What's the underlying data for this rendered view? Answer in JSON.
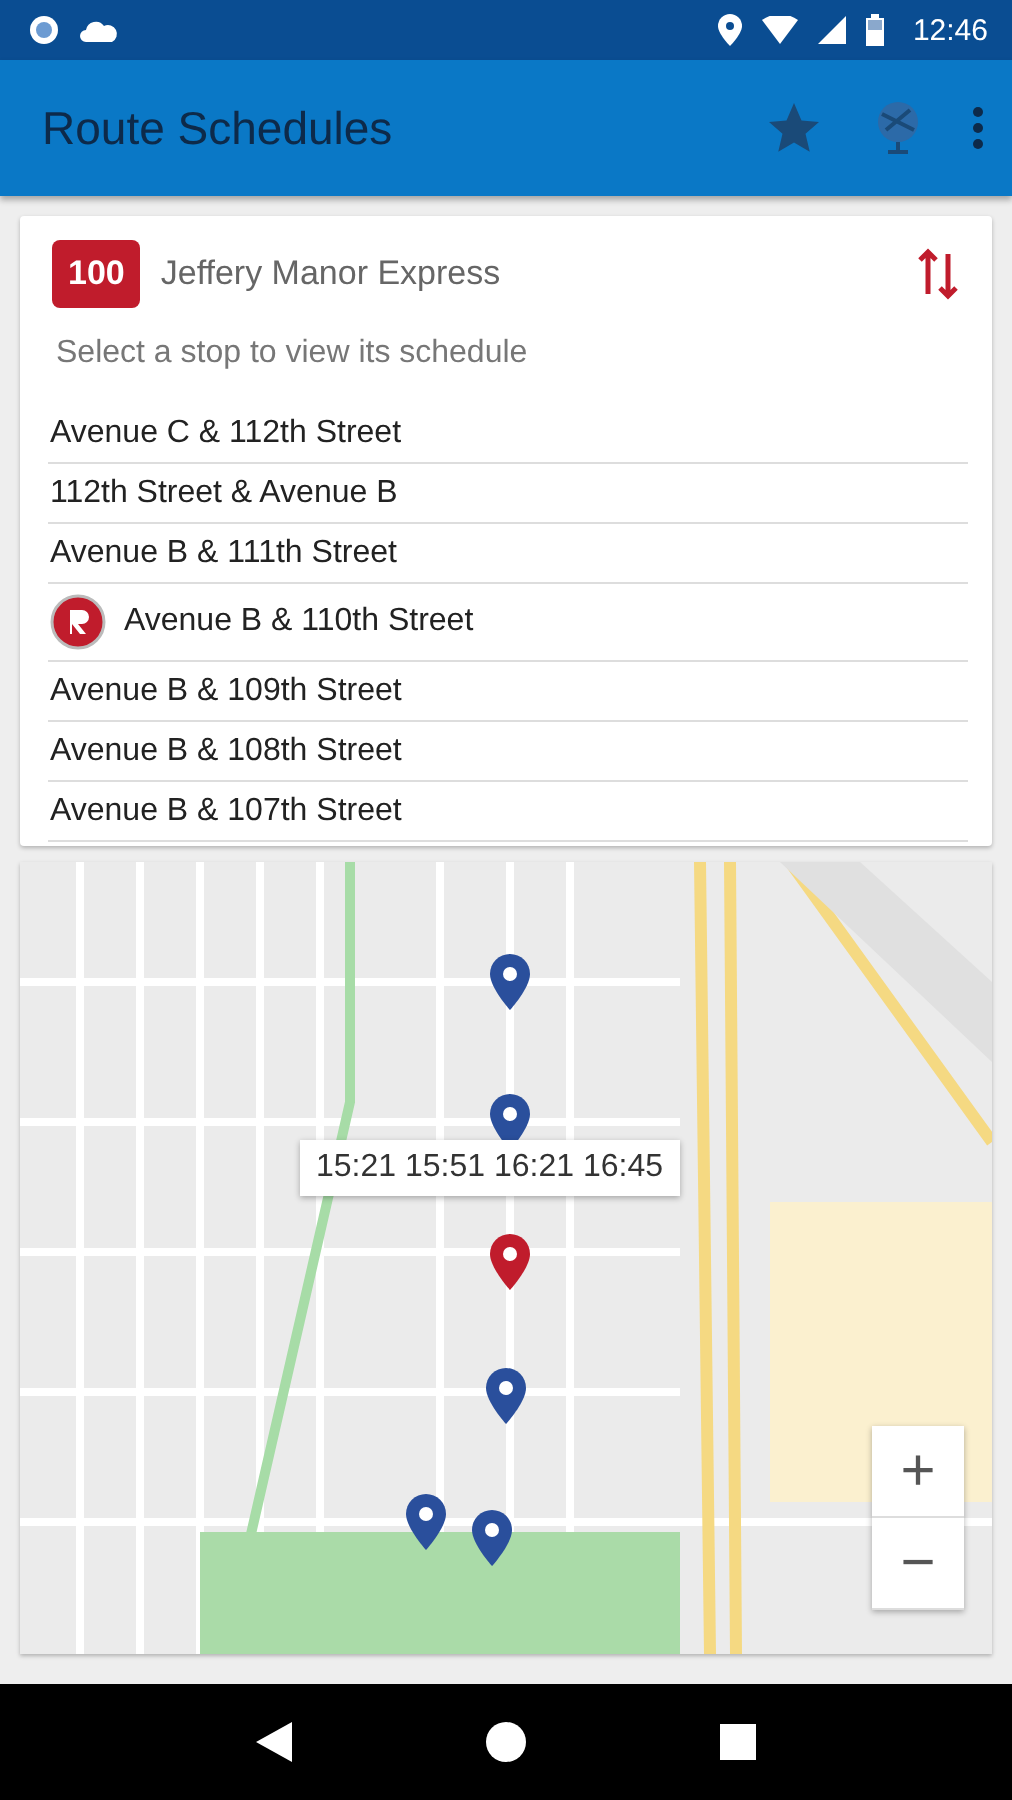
{
  "status_bar": {
    "time": "12:46"
  },
  "toolbar": {
    "title": "Route Schedules"
  },
  "route": {
    "number": "100",
    "name": "Jeffery Manor Express",
    "hint": "Select a stop to view its schedule"
  },
  "stops": [
    {
      "name": "Avenue C & 112th Street",
      "selected": false
    },
    {
      "name": "112th Street & Avenue B",
      "selected": false
    },
    {
      "name": "Avenue B & 111th Street",
      "selected": false
    },
    {
      "name": "Avenue B & 110th Street",
      "selected": true
    },
    {
      "name": "Avenue B & 109th Street",
      "selected": false
    },
    {
      "name": "Avenue B & 108th Street",
      "selected": false
    },
    {
      "name": "Avenue B & 107th Street",
      "selected": false
    }
  ],
  "map": {
    "popup": "15:21 15:51 16:21 16:45",
    "pins": [
      {
        "selected": false
      },
      {
        "selected": false
      },
      {
        "selected": true
      },
      {
        "selected": false
      },
      {
        "selected": false
      },
      {
        "selected": false
      }
    ],
    "zoom_in": "+",
    "zoom_out": "−"
  }
}
